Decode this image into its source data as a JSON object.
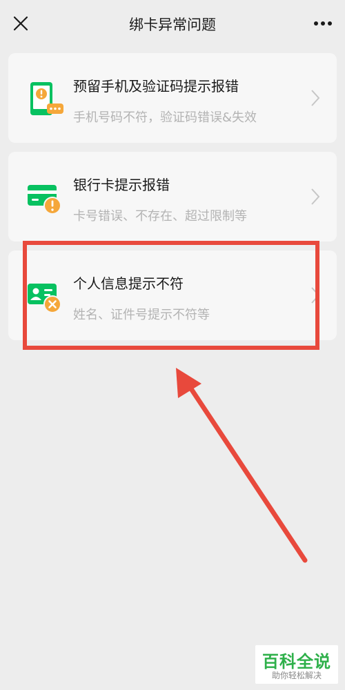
{
  "header": {
    "title": "绑卡异常问题",
    "close_icon": "close-icon",
    "more_icon": "more-icon"
  },
  "items": [
    {
      "title": "预留手机及验证码提示报错",
      "subtitle": "手机号码不符，验证码错误&失效",
      "icon": "phone-alert-icon"
    },
    {
      "title": "银行卡提示报错",
      "subtitle": "卡号错误、不存在、超过限制等",
      "icon": "card-alert-icon"
    },
    {
      "title": "个人信息提示不符",
      "subtitle": "姓名、证件号提示不符等",
      "icon": "id-card-error-icon"
    }
  ],
  "watermark": {
    "main": "百科全说",
    "sub": "助你轻松解决"
  },
  "colors": {
    "background": "#ededed",
    "card": "#f7f7f7",
    "green": "#07c160",
    "orange": "#f5a73a",
    "annotation_red": "#e8493c",
    "watermark_green": "#2eb04a"
  }
}
